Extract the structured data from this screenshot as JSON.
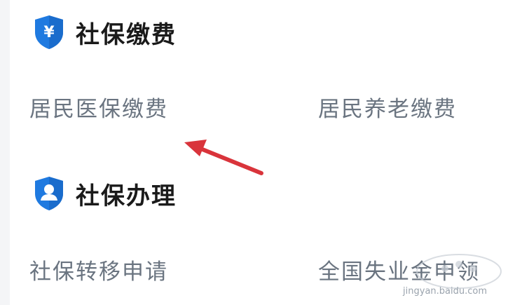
{
  "colors": {
    "accent": "#1f7ae0",
    "title": "#1a1a1a",
    "item_text": "#6a7480",
    "arrow": "#d9343b"
  },
  "sections": [
    {
      "icon": "yen-shield-icon",
      "title": "社保缴费",
      "items": [
        "居民医保缴费",
        "居民养老缴费"
      ]
    },
    {
      "icon": "user-shield-icon",
      "title": "社保办理",
      "items": [
        "社保转移申请",
        "全国失业金申领"
      ]
    }
  ],
  "watermark": {
    "url": "jingyan.baidu.com"
  }
}
